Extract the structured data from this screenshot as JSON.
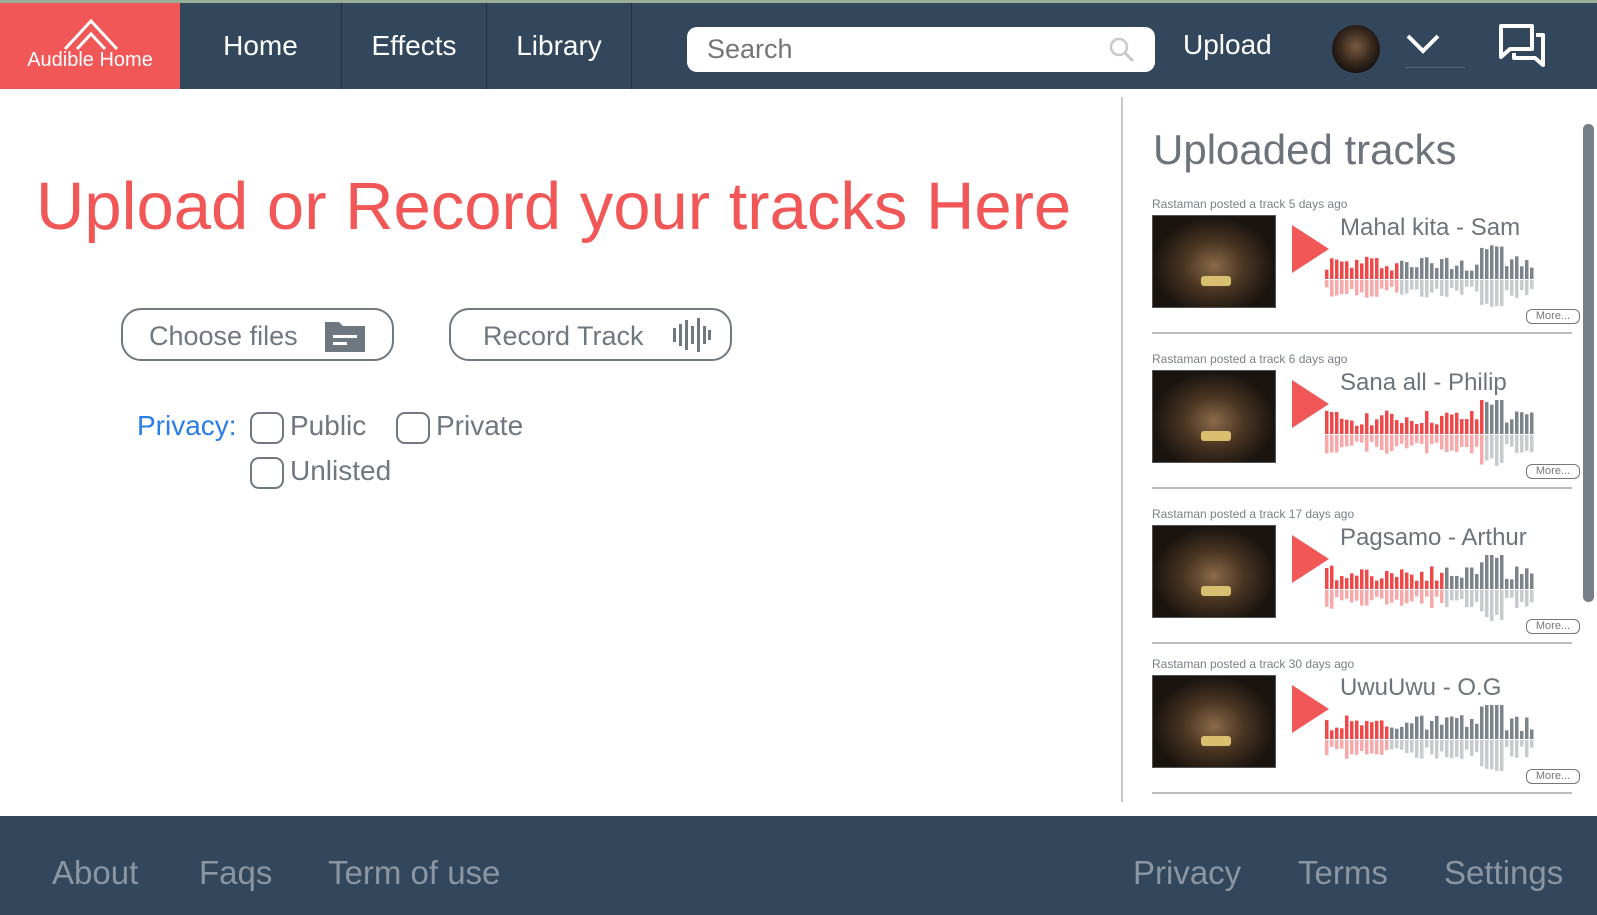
{
  "nav": {
    "logo": "Audible Home",
    "items": [
      "Home",
      "Effects",
      "Library"
    ],
    "search_placeholder": "Search",
    "upload": "Upload"
  },
  "main": {
    "title": "Upload or Record your tracks Here",
    "choose_files": "Choose files",
    "record_track": "Record Track",
    "privacy_label": "Privacy:",
    "options": [
      "Public",
      "Private",
      "Unlisted"
    ]
  },
  "sidebar": {
    "title": "Uploaded tracks",
    "more": "More...",
    "tracks": [
      {
        "meta": "Rastaman posted a track 5 days ago",
        "name": "Mahal kita - Sam",
        "progress": 0.34
      },
      {
        "meta": "Rastaman posted a track 6 days ago",
        "name": "Sana all - Philip",
        "progress": 0.75
      },
      {
        "meta": "Rastaman posted a track 17 days ago",
        "name": "Pagsamo - Arthur",
        "progress": 0.55
      },
      {
        "meta": "Rastaman posted a track 30 days ago",
        "name": "UwuUwu - O.G",
        "progress": 0.3
      }
    ]
  },
  "footer": {
    "left": [
      "About",
      "Faqs",
      "Term of use"
    ],
    "right": [
      "Privacy",
      "Terms",
      "Settings"
    ]
  },
  "colors": {
    "accent": "#f25757",
    "nav": "#32465c",
    "link": "#2b7de9"
  }
}
